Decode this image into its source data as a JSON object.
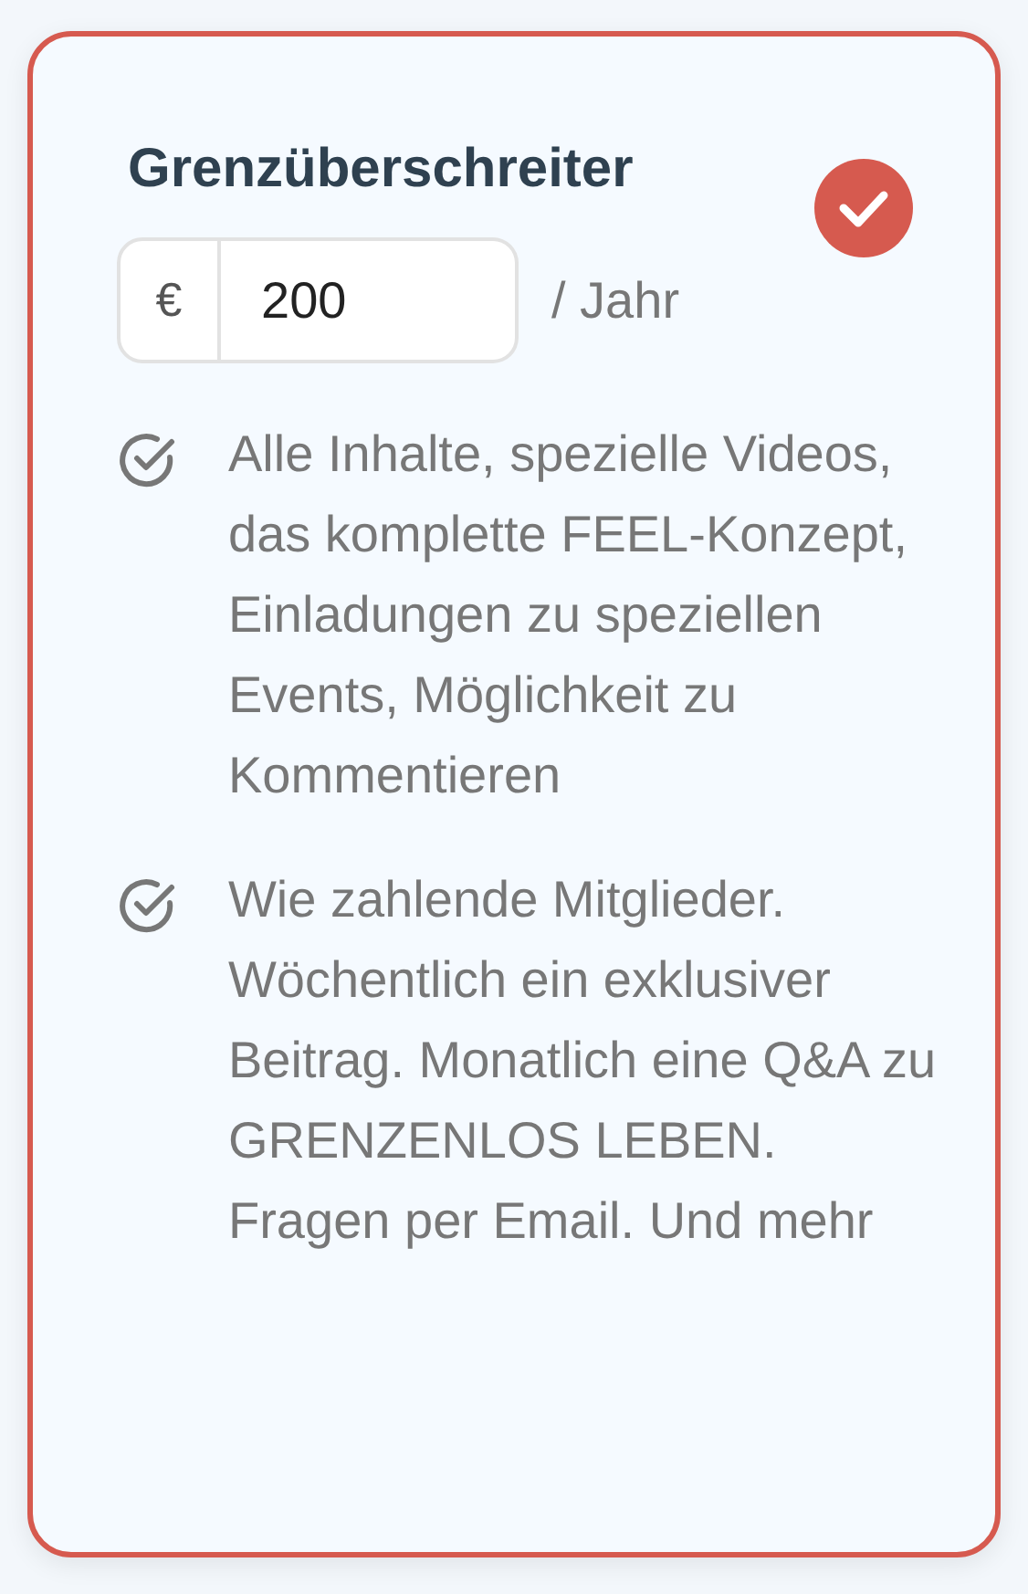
{
  "plan": {
    "title": "Grenzüberschreiter",
    "selected": true,
    "price": {
      "currency": "€",
      "value": "200",
      "period": "/ Jahr"
    },
    "features": [
      {
        "text": "Alle Inhalte, spezielle Videos, das komplette FEEL-Konzept, Einladungen zu speziellen Events, Möglichkeit zu Kommentieren"
      },
      {
        "text": "Wie zahlende Mitglieder. Wöchentlich ein exklusiver Beitrag. Monatlich eine Q&A zu GRENZENLOS LEBEN. Fragen per Email. Und mehr"
      }
    ]
  }
}
